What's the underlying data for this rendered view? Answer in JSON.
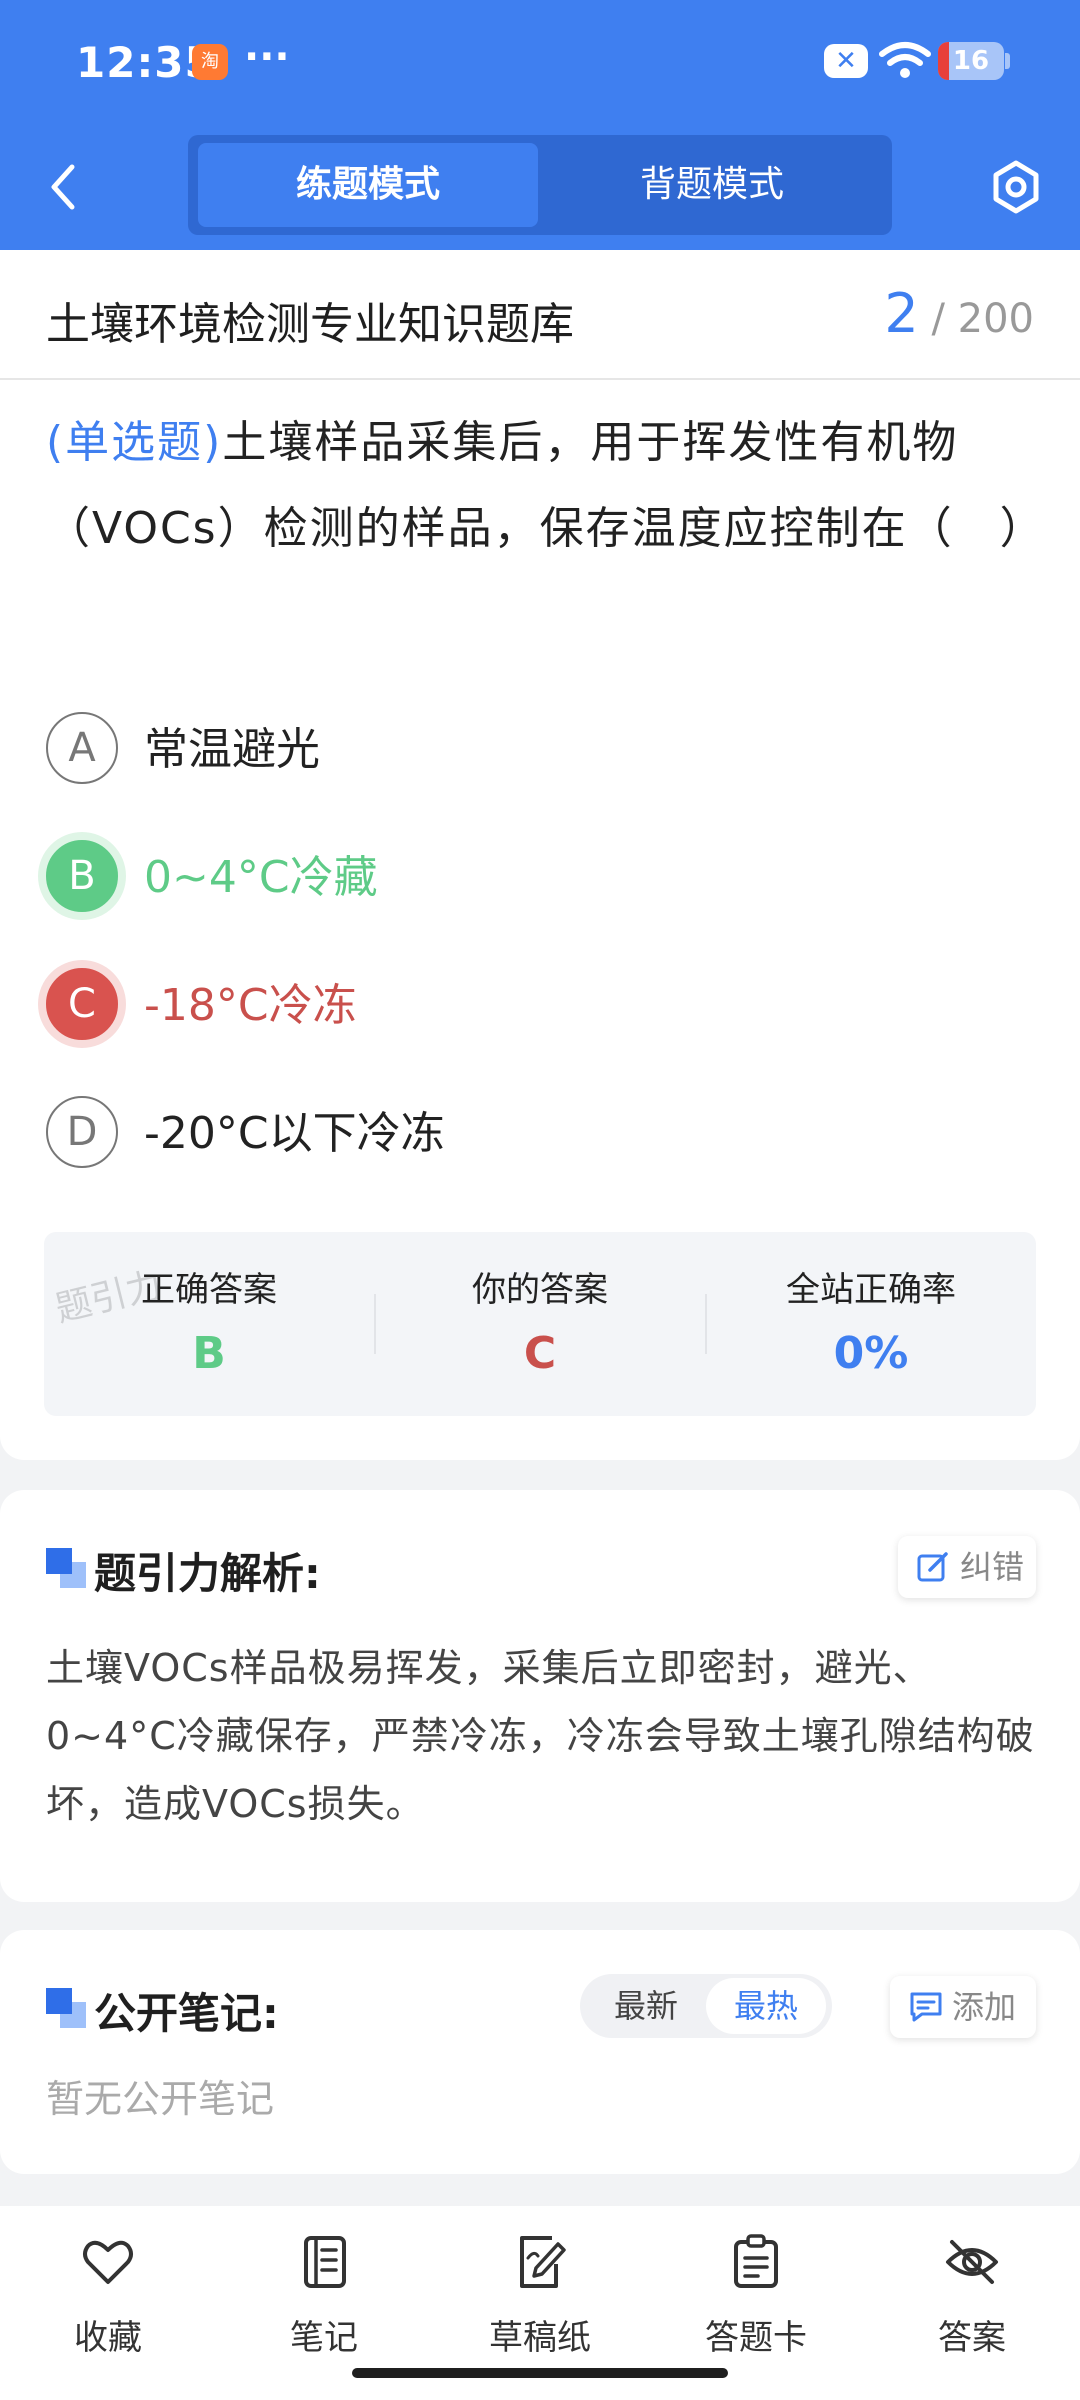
{
  "status_bar": {
    "time": "12:35",
    "app_badge": "淘",
    "more": "···",
    "x_badge": "✕",
    "battery": "16",
    "battery_level_percent": 16
  },
  "header": {
    "tabs": [
      {
        "label": "练题模式",
        "active": true
      },
      {
        "label": "背题模式",
        "active": false
      }
    ]
  },
  "question_bank": {
    "title": "土壤环境检测专业知识题库",
    "current": "2",
    "total_text": "/ 200"
  },
  "question": {
    "type": "(单选题)",
    "text": "土壤样品采集后，用于挥发性有机物（VOCs）检测的样品，保存温度应控制在（　）"
  },
  "options": [
    {
      "letter": "A",
      "text": "常温避光",
      "state": "normal"
    },
    {
      "letter": "B",
      "text": "0~4°C冷藏",
      "state": "correct"
    },
    {
      "letter": "C",
      "text": "-18°C冷冻",
      "state": "wrong"
    },
    {
      "letter": "D",
      "text": "-20°C以下冷冻",
      "state": "normal"
    }
  ],
  "stats": {
    "watermark": "题引力",
    "correct_label": "正确答案",
    "correct_value": "B",
    "yours_label": "你的答案",
    "yours_value": "C",
    "rate_label": "全站正确率",
    "rate_value": "0%"
  },
  "analysis": {
    "title": "题引力解析:",
    "report_label": "纠错",
    "text": "土壤VOCs样品极易挥发，采集后立即密封，避光、0~4°C冷藏保存，严禁冷冻，冷冻会导致土壤孔隙结构破坏，造成VOCs损失。"
  },
  "notes": {
    "title": "公开笔记:",
    "sort_latest": "最新",
    "sort_hot": "最热",
    "add_label": "添加",
    "empty_text": "暂无公开笔记"
  },
  "bottom_nav": [
    {
      "label": "收藏",
      "icon": "heart-icon"
    },
    {
      "label": "笔记",
      "icon": "notebook-icon"
    },
    {
      "label": "草稿纸",
      "icon": "draft-icon"
    },
    {
      "label": "答题卡",
      "icon": "answer-card-icon"
    },
    {
      "label": "答案",
      "icon": "eye-off-icon"
    }
  ],
  "colors": {
    "primary": "#3f7ff0",
    "correct": "#5ecb87",
    "wrong": "#d9534f"
  }
}
